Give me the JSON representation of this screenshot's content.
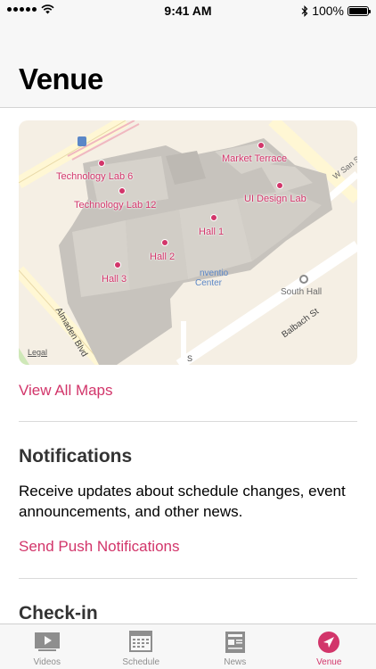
{
  "status_bar": {
    "time": "9:41 AM",
    "battery": "100%",
    "battery_level": 1.0
  },
  "header": {
    "title": "Venue"
  },
  "map": {
    "labels": {
      "market_terrace": "Market Terrace",
      "tech_lab_6": "Technology Lab 6",
      "tech_lab_12": "Technology Lab 12",
      "ui_design_lab": "UI Design Lab",
      "hall_1": "Hall 1",
      "hall_2": "Hall 2",
      "hall_3": "Hall 3"
    },
    "streets": {
      "w_san": "W San S",
      "almaden": "Almaden Blvd",
      "balbach": "Balbach St",
      "south_hall": "South Hall",
      "convention": "nventio",
      "center": "Center",
      "s_fragment": "S"
    },
    "legal": "Legal"
  },
  "view_all_maps": "View All Maps",
  "notifications": {
    "title": "Notifications",
    "body": "Receive updates about schedule changes, event announcements, and other news.",
    "action": "Send Push Notifications"
  },
  "checkin": {
    "title": "Check-in"
  },
  "tabs": [
    {
      "label": "Videos",
      "icon": "videos-icon"
    },
    {
      "label": "Schedule",
      "icon": "schedule-icon"
    },
    {
      "label": "News",
      "icon": "news-icon"
    },
    {
      "label": "Venue",
      "icon": "venue-icon"
    }
  ],
  "colors": {
    "accent": "#d2356a",
    "inactive": "#8e8e8e",
    "bar_bg": "#f7f7f7"
  }
}
